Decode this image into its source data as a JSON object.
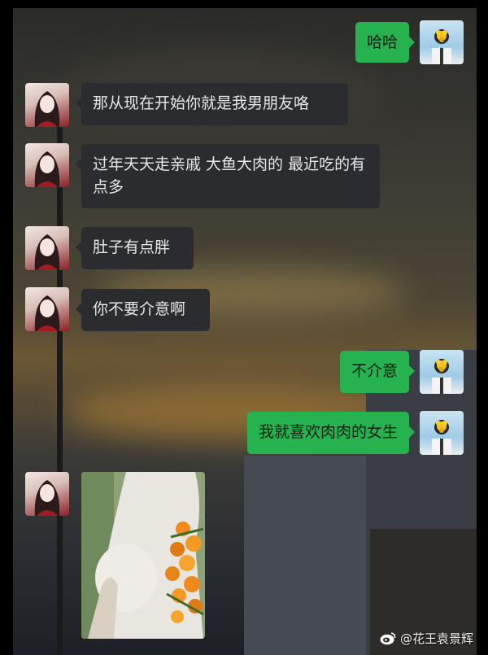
{
  "chat": {
    "messages": [
      {
        "side": "out",
        "text": "哈哈"
      },
      {
        "side": "in",
        "text": "那从现在开始你就是我男朋友咯"
      },
      {
        "side": "in",
        "text": "过年天天走亲戚 大鱼大肉的  最近吃的有点多"
      },
      {
        "side": "in",
        "text": "肚子有点胖"
      },
      {
        "side": "in",
        "text": "你不要介意啊"
      },
      {
        "side": "out",
        "text": "不介意"
      },
      {
        "side": "out",
        "text": "我就喜欢肉肉的女生"
      },
      {
        "side": "in",
        "type": "image",
        "icon": "photo-pregnant-woman-flowers"
      }
    ]
  },
  "watermark": {
    "text": "@花王袁景辉",
    "icon": "weibo-icon"
  },
  "colors": {
    "incoming_bubble": "#2b2c2f",
    "outgoing_bubble": "#26b24e"
  }
}
